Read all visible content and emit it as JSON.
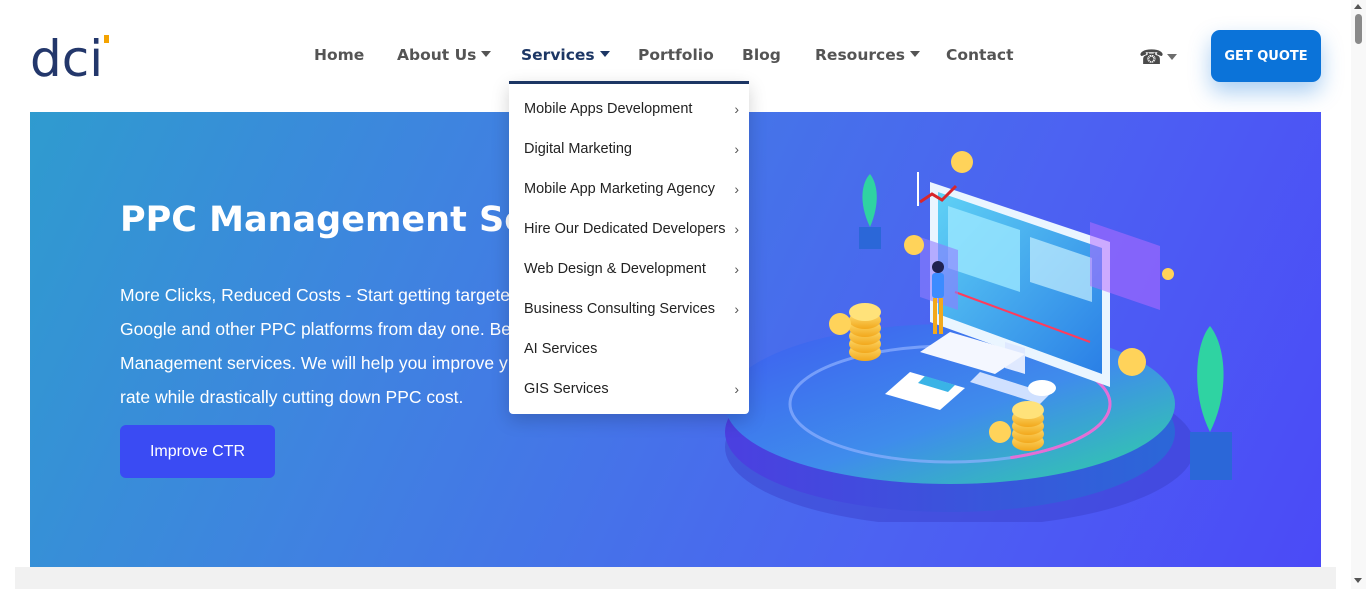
{
  "brand": {
    "logo_text": "dci",
    "logo_colors": {
      "letters": "#23376b",
      "accent": "#f4a300"
    }
  },
  "nav": {
    "items": [
      {
        "label": "Home",
        "has_caret": false,
        "active": false
      },
      {
        "label": "About Us",
        "has_caret": true,
        "active": false
      },
      {
        "label": "Services",
        "has_caret": true,
        "active": true
      },
      {
        "label": "Portfolio",
        "has_caret": false,
        "active": false
      },
      {
        "label": "Blog",
        "has_caret": false,
        "active": false
      },
      {
        "label": "Resources",
        "has_caret": true,
        "active": false
      },
      {
        "label": "Contact",
        "has_caret": false,
        "active": false
      }
    ],
    "phone_icon": "telephone-icon",
    "quote_button": "GET QUOTE"
  },
  "services_menu": {
    "items": [
      {
        "label": "Mobile Apps Development",
        "has_submenu": true
      },
      {
        "label": "Digital Marketing",
        "has_submenu": true
      },
      {
        "label": "Mobile App Marketing Agency",
        "has_submenu": true
      },
      {
        "label": "Hire Our Dedicated Developers",
        "has_submenu": true
      },
      {
        "label": "Web Design & Development",
        "has_submenu": true
      },
      {
        "label": "Business Consulting Services",
        "has_submenu": true
      },
      {
        "label": "AI Services",
        "has_submenu": false
      },
      {
        "label": "GIS Services",
        "has_submenu": true
      }
    ],
    "chevron": "›"
  },
  "hero": {
    "title": "PPC Management Serv",
    "lines": [
      "More Clicks, Reduced Costs - Start getting targete",
      "Google and other PPC platforms from day one. Be",
      "Management services. We will help you improve y",
      "rate while drastically cutting down PPC cost."
    ],
    "cta": "Improve CTR"
  },
  "colors": {
    "active_nav": "#1c3664",
    "quote_button": "#0b73d9",
    "cta": "#3a4bf3",
    "hero_gradient_start": "#2f9bcf",
    "hero_gradient_end": "#4b4af7"
  }
}
